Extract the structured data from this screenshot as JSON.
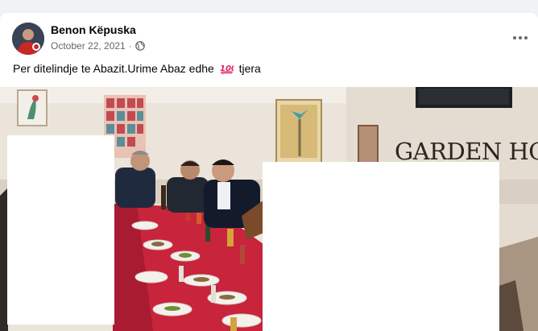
{
  "post": {
    "author": "Benon Këpuska",
    "date": "October 22, 2021",
    "date_separator": "·",
    "audience_icon": "globe-icon",
    "more_icon": "more-options-icon",
    "caption_before": "Per ditelindje te Abazit.Urime Abaz edhe",
    "caption_emoji": "💯",
    "caption_after": "tjera"
  },
  "photo": {
    "sign_text": "GARDEN HOUSE"
  },
  "colors": {
    "background": "#f0f2f5",
    "card": "#ffffff",
    "secondary_text": "#65676b",
    "tablecloth": "#c8243b",
    "wall": "#e9e1d7"
  }
}
